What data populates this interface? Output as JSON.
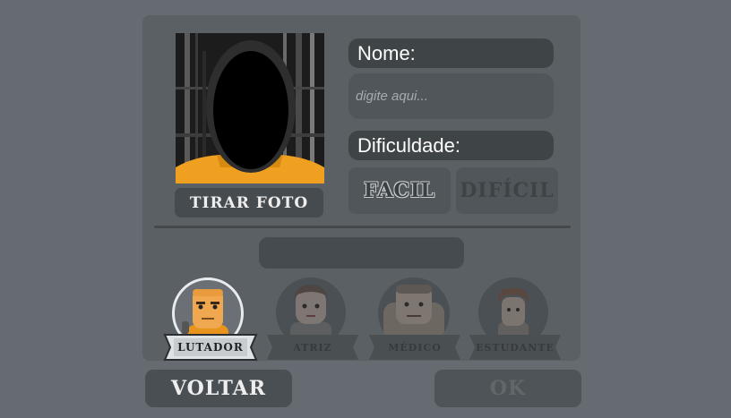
{
  "form": {
    "photo_button": "TIRAR FOTO",
    "name_label": "Nome:",
    "name_placeholder": "digite aqui...",
    "name_value": "",
    "difficulty_label": "Dificuldade:",
    "difficulty_options": [
      "FACIL",
      "DIFÍCIL"
    ],
    "selected_difficulty": "FACIL"
  },
  "characters": [
    {
      "label": "LUTADOR",
      "selected": true
    },
    {
      "label": "ATRIZ",
      "selected": false
    },
    {
      "label": "MÉDICO",
      "selected": false
    },
    {
      "label": "ESTUDANTE",
      "selected": false
    }
  ],
  "footer": {
    "back_label": "VOLTAR",
    "ok_label": "OK"
  },
  "colors": {
    "background": "#656b70",
    "panel": "#5a6064",
    "jumpsuit_orange": "#f0a020"
  }
}
